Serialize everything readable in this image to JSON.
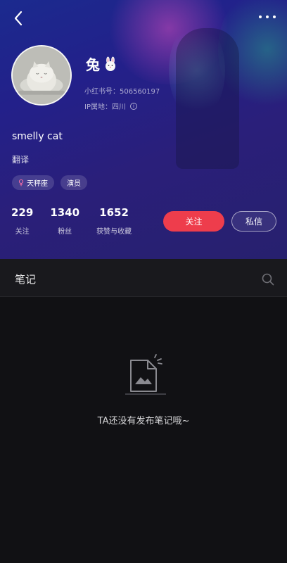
{
  "profile": {
    "nickname": "兔",
    "nickname_emoji": "rabbit-face-icon",
    "red_id_label": "小红书号：",
    "red_id": "506560197",
    "ip_label": "IP属地：",
    "ip_location": "四川",
    "username": "smelly cat",
    "bio": "翻译",
    "tags": [
      "天秤座",
      "演员"
    ]
  },
  "stats": [
    {
      "value": "229",
      "label": "关注"
    },
    {
      "value": "1340",
      "label": "粉丝"
    },
    {
      "value": "1652",
      "label": "获赞与收藏"
    }
  ],
  "actions": {
    "follow": "关注",
    "message": "私信"
  },
  "notes": {
    "tab_title": "笔记",
    "empty_text": "TA还没有发布笔记哦~"
  },
  "colors": {
    "follow_button": "#ee3d4c",
    "header_bg": "#23208a",
    "content_bg": "#111114"
  },
  "icons": {
    "back": "chevron-left-icon",
    "more": "more-dots-icon",
    "search": "search-icon",
    "gender": "female-icon",
    "empty": "empty-document-icon",
    "info": "info-icon"
  }
}
